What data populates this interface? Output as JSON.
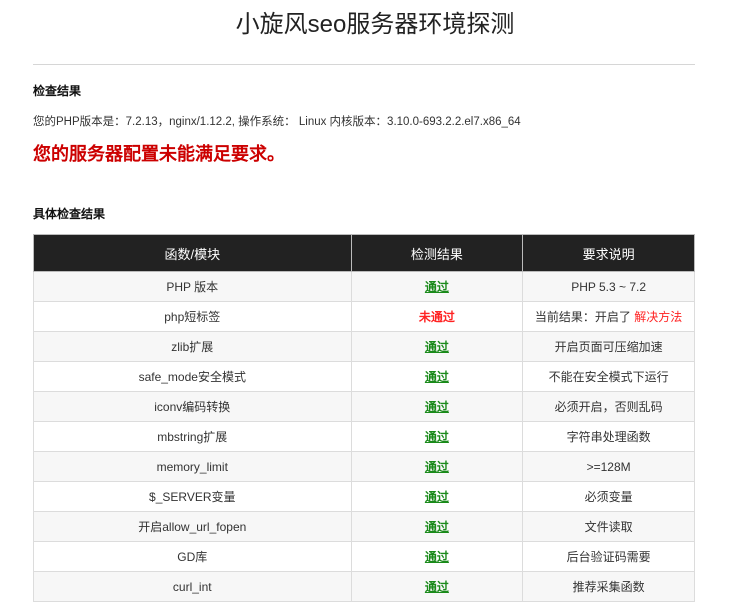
{
  "page": {
    "title": "小旋风seo服务器环境探测",
    "section1_title": "检查结果",
    "env_info": "您的PHP版本是：7.2.13，nginx/1.12.2, 操作系统： Linux 内核版本：3.10.0-693.2.2.el7.x86_64",
    "fail_message": "您的服务器配置未能满足要求。",
    "section2_title": "具体检查结果"
  },
  "table": {
    "headers": [
      "函数/模块",
      "检测结果",
      "要求说明"
    ],
    "rows": [
      {
        "module": "PHP 版本",
        "result": "通过",
        "status": "pass",
        "note": "PHP 5.3 ~ 7.2"
      },
      {
        "module": "php短标签",
        "result": "未通过",
        "status": "fail",
        "note": "当前结果：开启了",
        "link": "解决方法"
      },
      {
        "module": "zlib扩展",
        "result": "通过",
        "status": "pass",
        "note": "开启页面可压缩加速"
      },
      {
        "module": "safe_mode安全模式",
        "result": "通过",
        "status": "pass",
        "note": "不能在安全模式下运行"
      },
      {
        "module": "iconv编码转换",
        "result": "通过",
        "status": "pass",
        "note": "必须开启，否则乱码"
      },
      {
        "module": "mbstring扩展",
        "result": "通过",
        "status": "pass",
        "note": "字符串处理函数"
      },
      {
        "module": "memory_limit",
        "result": "通过",
        "status": "pass",
        "note": ">=128M"
      },
      {
        "module": "$_SERVER变量",
        "result": "通过",
        "status": "pass",
        "note": "必须变量"
      },
      {
        "module": "开启allow_url_fopen",
        "result": "通过",
        "status": "pass",
        "note": "文件读取"
      },
      {
        "module": "GD库",
        "result": "通过",
        "status": "pass",
        "note": "后台验证码需要"
      },
      {
        "module": "curl_int",
        "result": "通过",
        "status": "pass",
        "note": "推荐采集函数"
      }
    ]
  },
  "colors": {
    "pass": "#1a8a1a",
    "fail": "#ff2222",
    "error_message": "#cc0000",
    "header_bg": "#222222"
  }
}
